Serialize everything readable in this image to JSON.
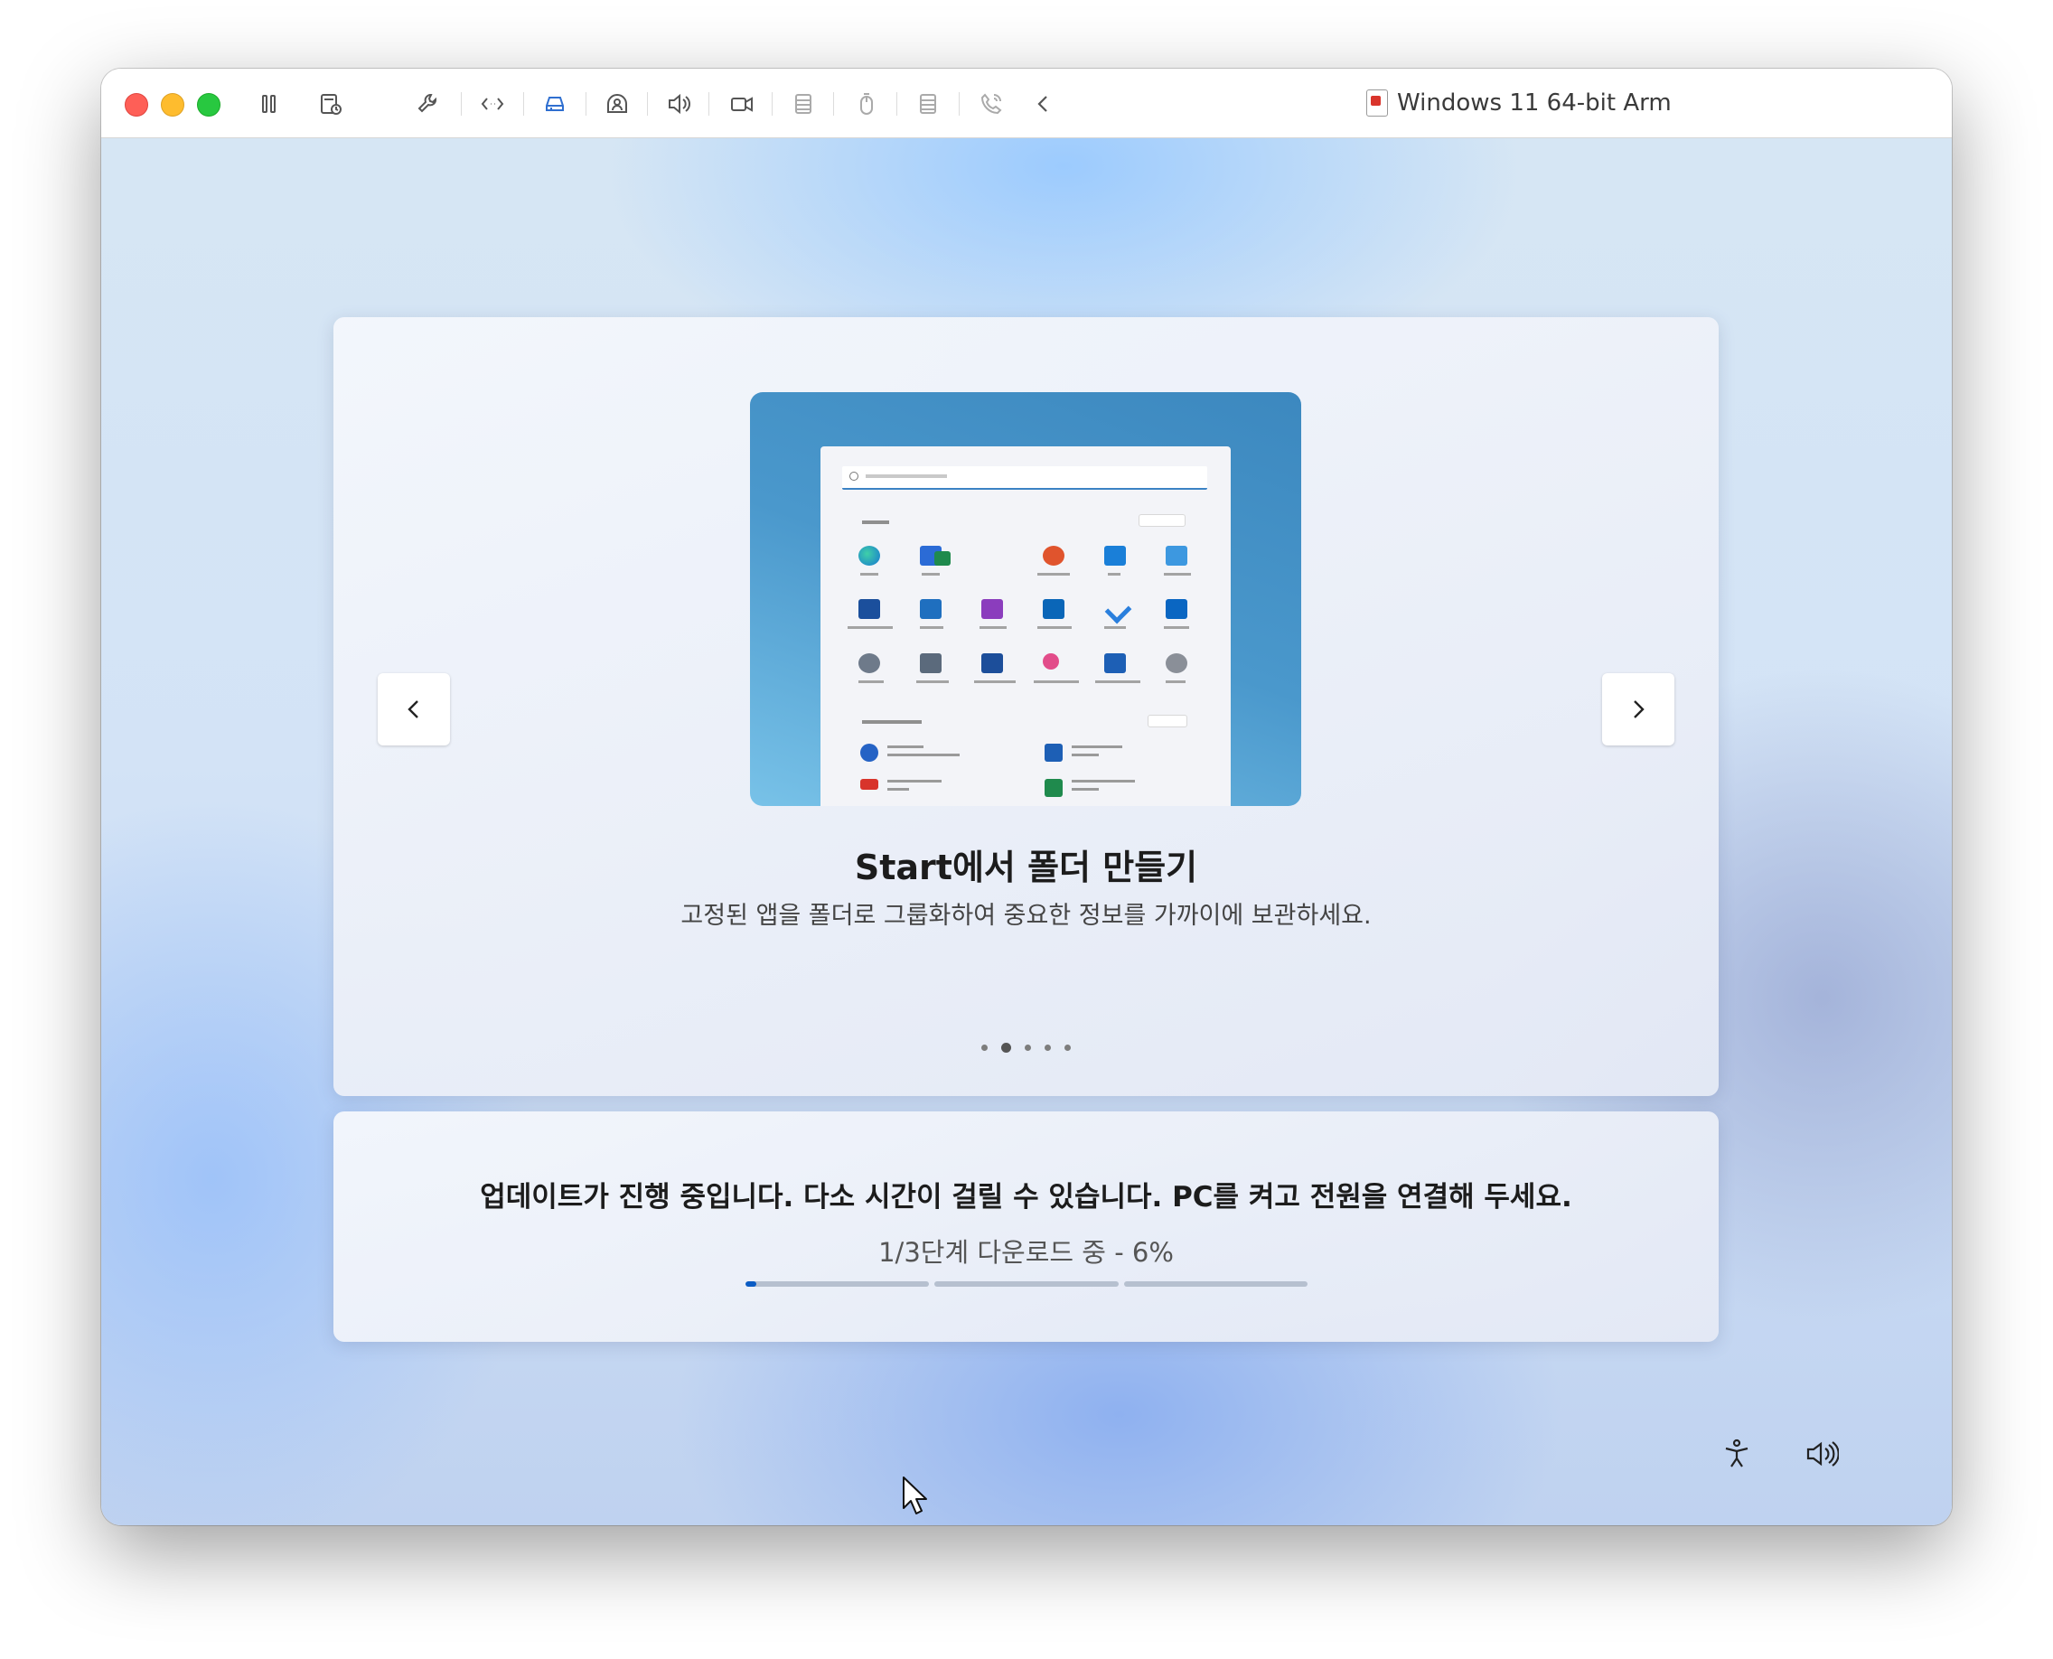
{
  "window": {
    "title": "Windows 11 64-bit Arm"
  },
  "toolbar": {
    "icons": [
      "pause-icon",
      "snapshot-icon",
      "wrench-icon",
      "code-icon",
      "disk-icon",
      "user-share-icon",
      "speaker-icon",
      "camera-icon",
      "printer-icon",
      "mouse-icon",
      "keyboard-icon",
      "phone-icon",
      "chevron-left-icon"
    ]
  },
  "slide": {
    "title": "Start에서 폴더 만들기",
    "description": "고정된 앱을 폴더로 그룹화하여 중요한 정보를 가까이에 보관하세요.",
    "dot_count": 5,
    "active_dot": 1
  },
  "update": {
    "message": "업데이트가 진행 중입니다. 다소 시간이 걸릴 수 있습니다. PC를 켜고 전원을 연결해 두세요.",
    "step_text": "1/3단계 다운로드 중 - 6%",
    "step_progress": 0.06,
    "steps": 3
  },
  "colors": {
    "accent": "#0b5cc4",
    "close": "#fe5f57",
    "minimize": "#febc2e",
    "maximize": "#28c840"
  }
}
